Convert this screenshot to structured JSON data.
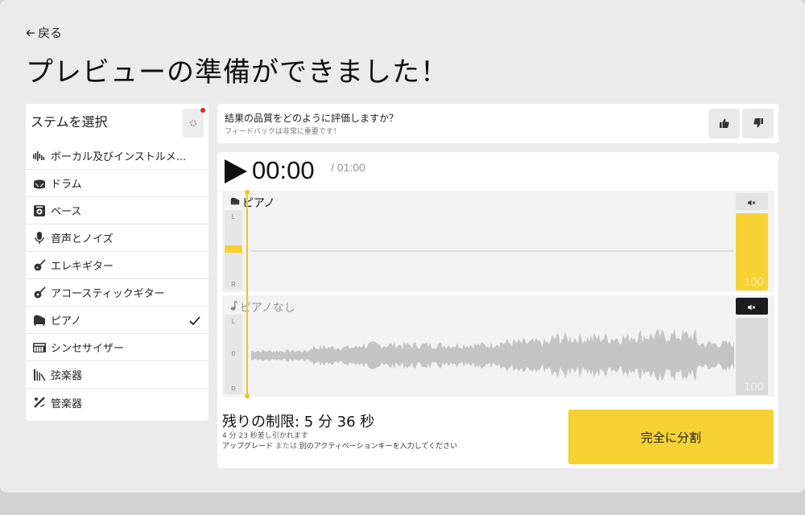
{
  "nav": {
    "back_label": "戻る"
  },
  "page": {
    "title": "プレビューの準備ができました！"
  },
  "sidebar": {
    "title": "ステムを選択",
    "items": [
      {
        "label": "ボーカル及びインストルメ...",
        "icon": "vocal-instrumental-icon",
        "selected": false
      },
      {
        "label": "ドラム",
        "icon": "drum-icon",
        "selected": false
      },
      {
        "label": "ベース",
        "icon": "bass-amp-icon",
        "selected": false
      },
      {
        "label": "音声とノイズ",
        "icon": "microphone-icon",
        "selected": false
      },
      {
        "label": "エレキギター",
        "icon": "electric-guitar-icon",
        "selected": false
      },
      {
        "label": "アコースティックギター",
        "icon": "acoustic-guitar-icon",
        "selected": false
      },
      {
        "label": "ピアノ",
        "icon": "piano-icon",
        "selected": true
      },
      {
        "label": "シンセサイザー",
        "icon": "synth-keyboard-icon",
        "selected": false
      },
      {
        "label": "弦楽器",
        "icon": "strings-icon",
        "selected": false
      },
      {
        "label": "管楽器",
        "icon": "wind-icon",
        "selected": false
      }
    ]
  },
  "feedback": {
    "question": "結果の品質をどのように評価しますか？",
    "subtext": "フィードバックは非常に重要です！"
  },
  "player": {
    "current_time": "00:00",
    "total_time": "/ 01:00",
    "tracks": [
      {
        "name": "ピアノ",
        "pan_labels": [
          "L",
          "0",
          "R"
        ],
        "volume": "100",
        "muted": false,
        "waveform": "flat"
      },
      {
        "name": "ピアノなし",
        "pan_labels": [
          "L",
          "0",
          "R"
        ],
        "volume": "100",
        "muted": true,
        "waveform": "full"
      }
    ]
  },
  "limit": {
    "title": "残りの制限: 5 分 36 秒",
    "deduct": "4 分 23 秒差し引かれます",
    "upgrade": "アップグレード",
    "or": "または",
    "other_key": "別のアクティベーションキーを入力してください"
  },
  "actions": {
    "split_label": "完全に分割"
  },
  "colors": {
    "accent": "#f6d132",
    "playhead": "#f5c518",
    "background": "#ebebeb"
  }
}
